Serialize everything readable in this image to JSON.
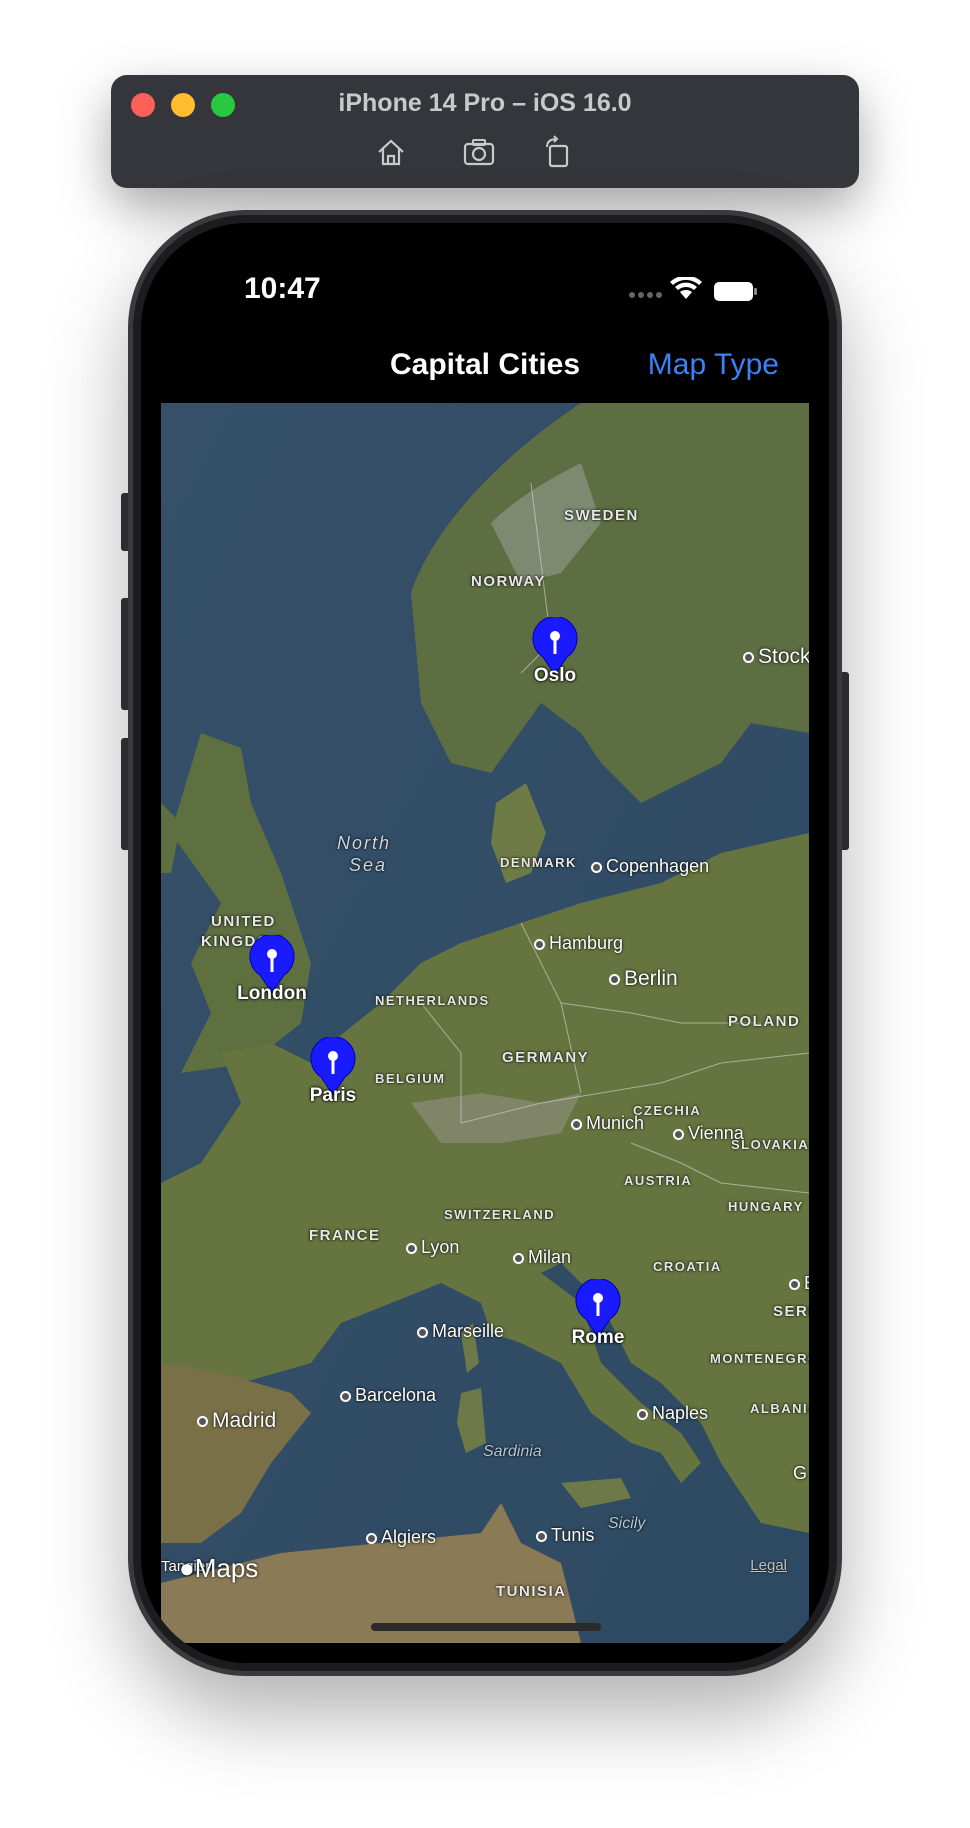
{
  "window": {
    "title": "iPhone 14 Pro – iOS 16.0"
  },
  "toolbar": {
    "icons": [
      "home-icon",
      "screenshot-icon",
      "rotate-icon"
    ]
  },
  "status_bar": {
    "time": "10:47"
  },
  "nav": {
    "title": "Capital Cities",
    "right_button": "Map Type"
  },
  "map": {
    "countries": {
      "sweden": "SWEDEN",
      "norway": "NORWAY",
      "denmark": "DENMARK",
      "uk_line1": "UNITED",
      "uk_line2": "KINGDOM",
      "netherlands": "NETHERLANDS",
      "belgium": "BELGIUM",
      "germany": "GERMANY",
      "poland": "POLAND",
      "czechia": "CZECHIA",
      "slovakia": "SLOVAKIA",
      "austria": "AUSTRIA",
      "hungary": "HUNGARY",
      "switzerland": "SWITZERLAND",
      "france": "FRANCE",
      "croatia": "CROATIA",
      "montenegro": "MONTENEGRO",
      "albania": "ALBANIA",
      "serbia_partial": "SERB",
      "tunisia": "TUNISIA"
    },
    "cities": {
      "stockholm": "Stockh",
      "copenhagen": "Copenhagen",
      "hamburg": "Hamburg",
      "berlin": "Berlin",
      "munich": "Munich",
      "vienna": "Vienna",
      "lyon": "Lyon",
      "milan": "Milan",
      "marseille": "Marseille",
      "barcelona": "Barcelona",
      "madrid": "Madrid",
      "naples": "Naples",
      "algiers": "Algiers",
      "tunis": "Tunis",
      "tangier": "Tangier",
      "budapest_partial": "B",
      "greece_partial": "G"
    },
    "water": {
      "north_sea_line1": "North",
      "north_sea_line2": "Sea"
    },
    "islands": {
      "sardinia": "Sardinia",
      "sicily": "Sicily"
    },
    "pins": [
      {
        "label": "Oslo"
      },
      {
        "label": "London"
      },
      {
        "label": "Paris"
      },
      {
        "label": "Rome"
      }
    ],
    "pin_color": "#1a1aff",
    "attribution": {
      "logo": "Maps",
      "legal": "Legal"
    }
  },
  "colors": {
    "accent": "#3b82f6",
    "sea": "#3b5670",
    "land": "#5d6b3e"
  }
}
